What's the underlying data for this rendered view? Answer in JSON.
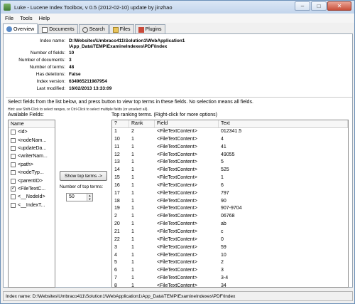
{
  "window": {
    "title": "Luke - Lucene Index Toolbox, v 0.5 (2012-02-10) update by jinzhao"
  },
  "menu": [
    "File",
    "Tools",
    "Help"
  ],
  "tabs": [
    {
      "label": "Overview",
      "icon": "overview-icon"
    },
    {
      "label": "Documents",
      "icon": "documents-icon"
    },
    {
      "label": "Search",
      "icon": "search-icon"
    },
    {
      "label": "Files",
      "icon": "files-icon"
    },
    {
      "label": "Plugins",
      "icon": "plugins-icon"
    }
  ],
  "overview": {
    "rows": [
      {
        "label": "Index name:",
        "value": "D:\\Websites\\Umbraco411\\Solution1\\WebApplication1"
      },
      {
        "label": "",
        "value": "\\App_Data\\TEMP\\ExamineIndexes\\PDF\\Index"
      },
      {
        "label": "Number of fields:",
        "value": "10"
      },
      {
        "label": "Number of documents:",
        "value": "3"
      },
      {
        "label": "Number of terms:",
        "value": "48"
      },
      {
        "label": "Has deletions:",
        "value": "False"
      },
      {
        "label": "Index version:",
        "value": "634965211987954"
      },
      {
        "label": "Last modified:",
        "value": "16/02/2013 13:33:09"
      }
    ]
  },
  "instructions": "Select fields from the list below, and press button to view top terms in these fields. No selection means all fields.",
  "hint": "Hint: use Shift-Click to select ranges, or Ctrl-Click to select multiple fields (or unselect all).",
  "fields": {
    "label": "Available Fields:",
    "header": "Name",
    "items": [
      {
        "name": "<id>",
        "checked": false
      },
      {
        "name": "<nodeNam...",
        "checked": false
      },
      {
        "name": "<updateDa...",
        "checked": false
      },
      {
        "name": "<writerNam...",
        "checked": false
      },
      {
        "name": "<path>",
        "checked": false
      },
      {
        "name": "<nodeTyp...",
        "checked": false
      },
      {
        "name": "<parentID>",
        "checked": false
      },
      {
        "name": "<FileTextC...",
        "checked": true
      },
      {
        "name": "<__NodeId>",
        "checked": false
      },
      {
        "name": "<__IndexT...",
        "checked": false
      }
    ]
  },
  "controls": {
    "show_top_terms": "Show top terms ->",
    "num_top_terms_label": "Number of top terms:",
    "num_top_terms": "50"
  },
  "top_terms": {
    "label": "Top ranking terms. (Right-click for more options)",
    "columns": [
      "?",
      "Rank",
      "Field",
      "Text"
    ],
    "rows": [
      [
        "1",
        "2",
        "<FileTextContent>",
        "012341.5"
      ],
      [
        "10",
        "1",
        "<FileTextContent>",
        "4"
      ],
      [
        "11",
        "1",
        "<FileTextContent>",
        "41"
      ],
      [
        "12",
        "1",
        "<FileTextContent>",
        "49055"
      ],
      [
        "13",
        "1",
        "<FileTextContent>",
        "5"
      ],
      [
        "14",
        "1",
        "<FileTextContent>",
        "525"
      ],
      [
        "15",
        "1",
        "<FileTextContent>",
        "1"
      ],
      [
        "16",
        "1",
        "<FileTextContent>",
        "6"
      ],
      [
        "17",
        "1",
        "<FileTextContent>",
        "797"
      ],
      [
        "18",
        "1",
        "<FileTextContent>",
        "90"
      ],
      [
        "19",
        "1",
        "<FileTextContent>",
        "907-9704"
      ],
      [
        "2",
        "1",
        "<FileTextContent>",
        "06768"
      ],
      [
        "20",
        "1",
        "<FileTextContent>",
        "ab"
      ],
      [
        "21",
        "1",
        "<FileTextContent>",
        "c"
      ],
      [
        "22",
        "1",
        "<FileTextContent>",
        "0"
      ],
      [
        "3",
        "1",
        "<FileTextContent>",
        "59"
      ],
      [
        "4",
        "1",
        "<FileTextContent>",
        "10"
      ],
      [
        "5",
        "1",
        "<FileTextContent>",
        "2"
      ],
      [
        "6",
        "1",
        "<FileTextContent>",
        "3"
      ],
      [
        "7",
        "1",
        "<FileTextContent>",
        "3-4"
      ],
      [
        "8",
        "1",
        "<FileTextContent>",
        "34"
      ],
      [
        "9",
        "1",
        "<FileTextContent>",
        "37"
      ]
    ]
  },
  "status": "Index name: D:\\Websites\\Umbraco411\\Solution1\\WebApplication1\\App_Data\\TEMP\\ExamineIndexes\\PDF\\Index"
}
